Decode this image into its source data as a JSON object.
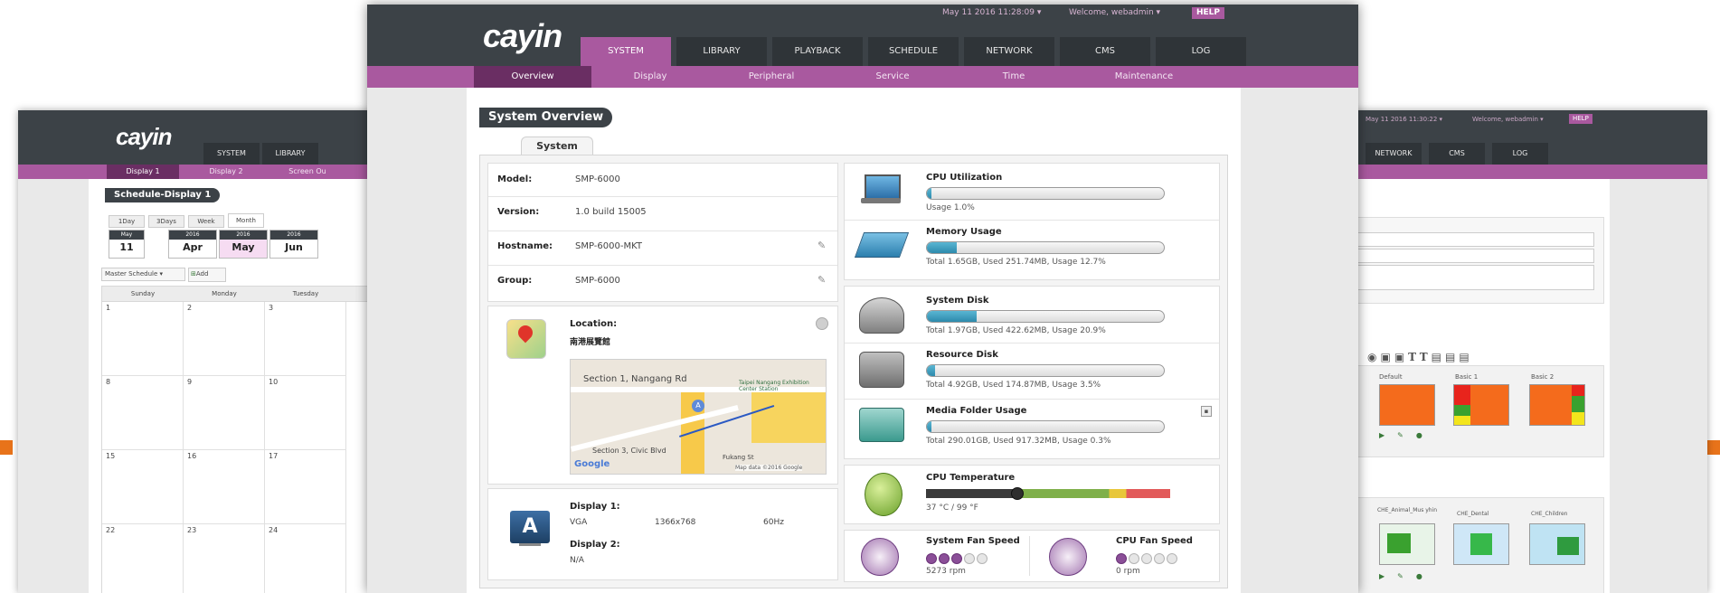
{
  "colors": {
    "accent": "#a9599f",
    "topbar": "#3c4247",
    "progress": "#2d8aac",
    "orange": "#e8731a"
  },
  "main": {
    "logo": "cayin",
    "datetime": "May 11 2016 11:28:09 ▾",
    "welcome": "Welcome, webadmin ▾",
    "help": "HELP",
    "tabs": [
      "SYSTEM",
      "LIBRARY",
      "PLAYBACK",
      "SCHEDULE",
      "NETWORK",
      "CMS",
      "LOG"
    ],
    "subtabs": [
      "Overview",
      "Display",
      "Peripheral",
      "Service",
      "Time",
      "Maintenance"
    ],
    "page_title": "System Overview",
    "section_tab": "System",
    "info": [
      {
        "label": "Model:",
        "value": "SMP-6000"
      },
      {
        "label": "Version:",
        "value": "1.0 build 15005"
      },
      {
        "label": "Hostname:",
        "value": "SMP-6000-MKT"
      },
      {
        "label": "Group:",
        "value": "SMP-6000"
      }
    ],
    "location": {
      "label": "Location:",
      "value": "南港展覽館",
      "map_street": "Section 1, Nangang Rd",
      "map_street2": "Section 3, Civic Blvd",
      "map_area": "Fukang St",
      "map_poi": "Taipei Nangang Exhibition Center Station",
      "map_credit": "Map data ©2016 Google",
      "map_brand": "Google"
    },
    "display": {
      "d1_label": "Display 1:",
      "d1_type": "VGA",
      "d1_res": "1366x768",
      "d1_freq": "60Hz",
      "d2_label": "Display 2:",
      "d2_value": "N/A",
      "icon_letter": "A"
    },
    "stats": {
      "cpu": {
        "title": "CPU Utilization",
        "caption": "Usage 1.0%",
        "fill": 0.01
      },
      "memory": {
        "title": "Memory Usage",
        "caption": "Total 1.65GB, Used 251.74MB, Usage 12.7%",
        "fill": 0.127
      },
      "system_disk": {
        "title": "System Disk",
        "caption": "Total 1.97GB, Used 422.62MB, Usage 20.9%",
        "fill": 0.209
      },
      "resource_disk": {
        "title": "Resource Disk",
        "caption": "Total 4.92GB, Used 174.87MB, Usage 3.5%",
        "fill": 0.035
      },
      "media_folder": {
        "title": "Media Folder Usage",
        "caption": "Total 290.01GB, Used 917.32MB, Usage 0.3%",
        "fill": 0.003
      },
      "cpu_temp": {
        "title": "CPU Temperature",
        "caption": "37 °C / 99 °F",
        "fill": 0.37
      },
      "sys_fan": {
        "title": "System Fan Speed",
        "caption": "5273 rpm",
        "level": 3,
        "max": 5
      },
      "cpu_fan": {
        "title": "CPU Fan Speed",
        "caption": "0 rpm",
        "level": 1,
        "max": 5
      }
    }
  },
  "left": {
    "logo": "cayin",
    "tabs": [
      "SYSTEM",
      "LIBRARY"
    ],
    "subtabs": [
      "Display 1",
      "Display 2",
      "Screen Ou"
    ],
    "title": "Schedule-Display 1",
    "view_tabs": [
      "1Day",
      "3Days",
      "Week",
      "Month"
    ],
    "dates": [
      {
        "top": "May",
        "bottom": "11"
      },
      {
        "top": "2016",
        "bottom": "Apr"
      },
      {
        "top": "2016",
        "bottom": "May"
      },
      {
        "top": "2016",
        "bottom": "Jun"
      }
    ],
    "master": "Master Schedule ▾",
    "add": "Add",
    "weekdays": [
      "Sunday",
      "Monday",
      "Tuesday"
    ],
    "rows": [
      [
        "1",
        "2",
        "3"
      ],
      [
        "8",
        "9",
        "10"
      ],
      [
        "15",
        "16",
        "17"
      ],
      [
        "22",
        "23",
        "24"
      ]
    ]
  },
  "right": {
    "datetime": "May 11 2016 11:30:22 ▾",
    "welcome": "Welcome, webadmin ▾",
    "help": "HELP",
    "tabs": [
      "NETWORK",
      "CMS",
      "LOG"
    ],
    "templates": [
      "Default",
      "Basic 1",
      "Basic 2"
    ],
    "media": [
      "CHE_Animal_Mus yhin",
      "CHE_Dental",
      "CHE_Children"
    ]
  }
}
